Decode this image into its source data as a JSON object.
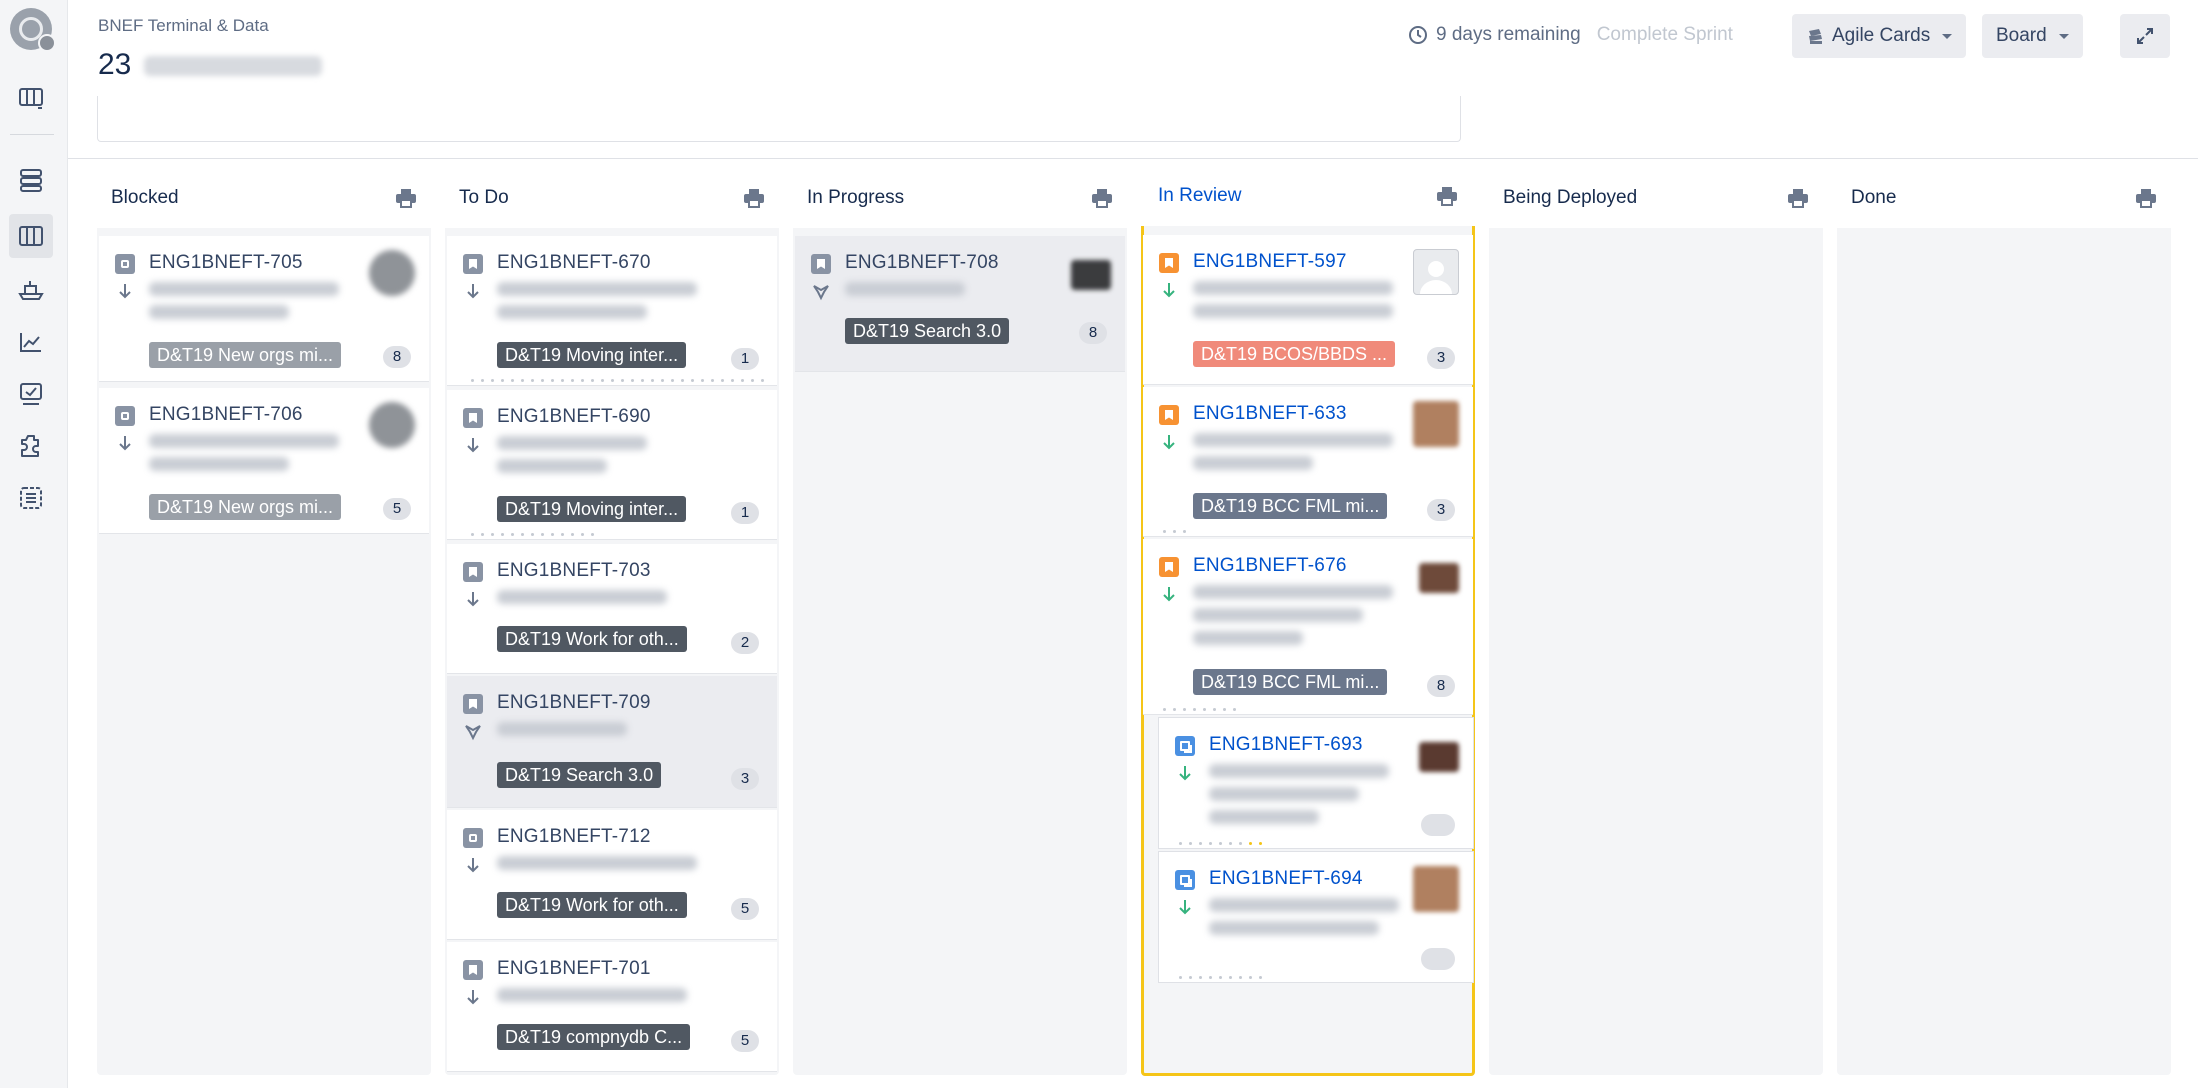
{
  "header": {
    "breadcrumb": "BNEF Terminal & Data",
    "sprint_number": "23",
    "time_remaining": "9 days remaining",
    "complete_sprint_label": "Complete Sprint",
    "agile_cards_label": "Agile Cards",
    "board_label": "Board"
  },
  "rail": {
    "icons": [
      "board-icon",
      "backlog-icon",
      "active-sprint-icon",
      "releases-icon",
      "reports-icon",
      "issues-icon",
      "components-icon",
      "checklist-icon"
    ]
  },
  "columns": [
    {
      "name": "Blocked",
      "cards": [
        {
          "key": "ENG1BNEFT-705",
          "epic": "D&T19 New orgs mi...",
          "estimate": "8"
        },
        {
          "key": "ENG1BNEFT-706",
          "epic": "D&T19 New orgs mi...",
          "estimate": "5"
        }
      ]
    },
    {
      "name": "To Do",
      "cards": [
        {
          "key": "ENG1BNEFT-670",
          "epic": "D&T19 Moving inter...",
          "estimate": "1"
        },
        {
          "key": "ENG1BNEFT-690",
          "epic": "D&T19 Moving inter...",
          "estimate": "1"
        },
        {
          "key": "ENG1BNEFT-703",
          "epic": "D&T19 Work for oth...",
          "estimate": "2"
        },
        {
          "key": "ENG1BNEFT-709",
          "epic": "D&T19 Search 3.0",
          "estimate": "3"
        },
        {
          "key": "ENG1BNEFT-712",
          "epic": "D&T19 Work for oth...",
          "estimate": "5"
        },
        {
          "key": "ENG1BNEFT-701",
          "epic": "D&T19 compnydb C...",
          "estimate": "5"
        }
      ]
    },
    {
      "name": "In Progress",
      "cards": [
        {
          "key": "ENG1BNEFT-708",
          "epic": "D&T19 Search 3.0",
          "estimate": "8"
        }
      ]
    },
    {
      "name": "In Review",
      "cards": [
        {
          "key": "ENG1BNEFT-597",
          "epic": "D&T19 BCOS/BBDS ...",
          "estimate": "3"
        },
        {
          "key": "ENG1BNEFT-633",
          "epic": "D&T19 BCC FML mi...",
          "estimate": "3"
        },
        {
          "key": "ENG1BNEFT-676",
          "epic": "D&T19 BCC FML mi...",
          "estimate": "8"
        },
        {
          "key": "ENG1BNEFT-693",
          "epic": "",
          "estimate": ""
        },
        {
          "key": "ENG1BNEFT-694",
          "epic": "",
          "estimate": ""
        }
      ]
    },
    {
      "name": "Being Deployed",
      "cards": []
    },
    {
      "name": "Done",
      "cards": []
    }
  ],
  "colors": {
    "accent_blue": "#0052cc",
    "in_review_highlight": "#f5c518",
    "story_icon_orange": "#f79232",
    "subtask_icon_blue": "#4a90e2",
    "priority_low_green": "#36b37e",
    "epic_coral": "#f08a7a"
  }
}
